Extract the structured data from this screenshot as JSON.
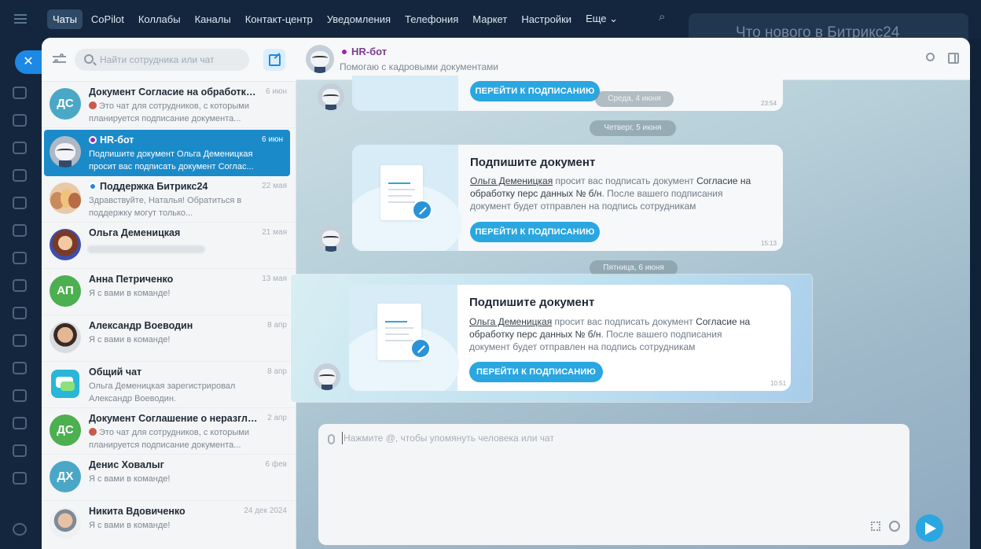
{
  "topnav": {
    "items": [
      "Чаты",
      "CoPilot",
      "Коллабы",
      "Каналы",
      "Контакт-центр",
      "Уведомления",
      "Телефония",
      "Маркет",
      "Настройки",
      "Еще"
    ],
    "more_chevron": "⌄"
  },
  "background_banner": "Что нового в Битрикс24",
  "close_symbol": "✕",
  "chatlist": {
    "search_placeholder": "Найти сотрудника или чат",
    "items": [
      {
        "initials": "ДС",
        "avatar_color": "#4aa8c6",
        "name": "Документ Согласие на обработку п...",
        "date": "6 июн",
        "preview": "Это чат для сотрудников, с которыми планируется подписание документа..."
      },
      {
        "name": "HR-бот",
        "date": "6 июн",
        "preview": "Подпишите документ Ольга Деменицкая просит вас подписать документ Соглас..."
      },
      {
        "name": "Поддержка Битрикс24",
        "date": "22 мая",
        "preview": "Здравствуйте, Наталья! Обратиться в поддержку могут только..."
      },
      {
        "name": "Ольга Деменицкая",
        "date": "21 мая",
        "preview": ""
      },
      {
        "initials": "АП",
        "avatar_color": "#4caf50",
        "name": "Анна Петриченко",
        "date": "13 мая",
        "preview": "Я с вами в команде!"
      },
      {
        "name": "Александр Воеводин",
        "date": "8 апр",
        "preview": "Я с вами в команде!"
      },
      {
        "name": "Общий чат",
        "date": "8 апр",
        "preview": "Ольга Деменицкая зарегистрировал Александр Воеводин."
      },
      {
        "initials": "ДС",
        "avatar_color": "#4caf50",
        "name": "Документ Соглашение о неразглаш...",
        "date": "2 апр",
        "preview": "Это чат для сотрудников, с которыми планируется подписание документа..."
      },
      {
        "initials": "ДХ",
        "avatar_color": "#4aa8c6",
        "name": "Денис Ховалыг",
        "date": "6 фев",
        "preview": "Я с вами в команде!"
      },
      {
        "name": "Никита Вдовиченко",
        "date": "24 дек 2024",
        "preview": "Я с вами в команде!"
      }
    ]
  },
  "chat": {
    "title": "HR-бот",
    "subtitle": "Помогаю с кадровыми документами",
    "date_pills": [
      "Среда, 4 июня",
      "Четверг, 5 июня",
      "Пятница, 6 июня"
    ],
    "messages": [
      {
        "button": "ПЕРЕЙТИ К ПОДПИСАНИЮ",
        "time": "23:54"
      },
      {
        "title": "Подпишите документ",
        "person": "Ольга Деменицкая",
        "text1": " просит вас подписать документ ",
        "doc": "Согласие на обработку перс данных № б/н",
        "text2": ". После вашего подписания документ будет отправлен на подпись сотрудникам",
        "button": "ПЕРЕЙТИ К ПОДПИСАНИЮ",
        "time": "15:13"
      },
      {
        "title": "Подпишите документ",
        "person": "Ольга Деменицкая",
        "text1": " просит вас подписать документ ",
        "doc": "Согласие на обработку перс данных № б/н",
        "text2": ". После вашего подписания документ будет отправлен на подпись сотрудникам",
        "button": "ПЕРЕЙТИ К ПОДПИСАНИЮ",
        "time": "10:51"
      }
    ],
    "input_placeholder": "Нажмите @, чтобы упомянуть человека или чат"
  }
}
